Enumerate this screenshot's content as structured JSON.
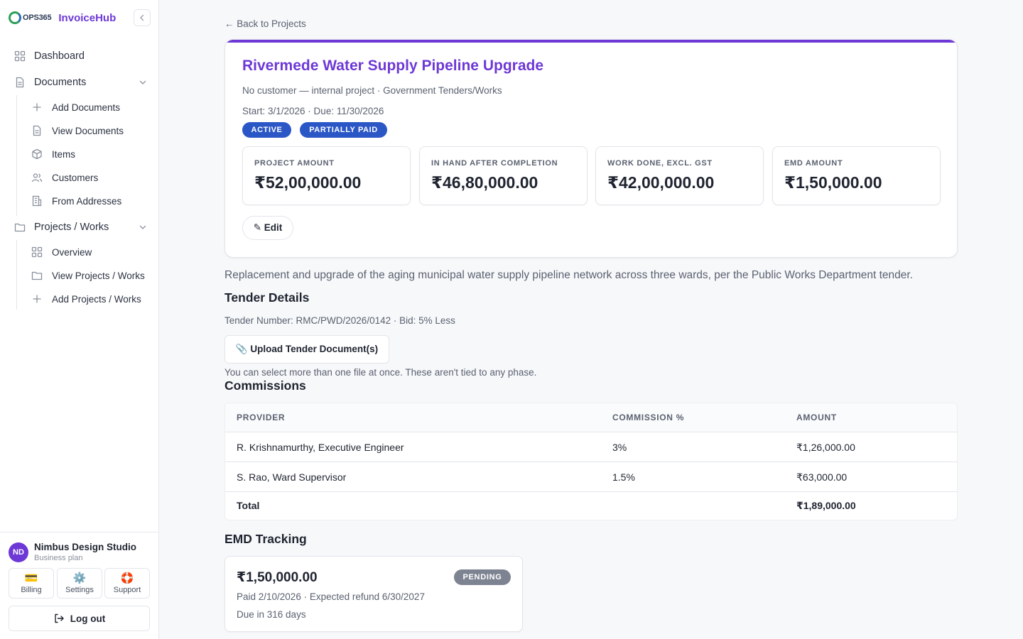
{
  "brand": {
    "logo_text": "OPS365",
    "app_name": "InvoiceHub"
  },
  "sidebar": {
    "items": [
      {
        "label": "Dashboard",
        "icon": "grid-icon"
      },
      {
        "label": "Documents",
        "icon": "document-icon",
        "expanded": true,
        "children": [
          {
            "label": "Add Documents",
            "icon": "plus-icon"
          },
          {
            "label": "View Documents",
            "icon": "document-icon"
          },
          {
            "label": "Items",
            "icon": "box-icon"
          },
          {
            "label": "Customers",
            "icon": "users-icon"
          },
          {
            "label": "From Addresses",
            "icon": "building-icon"
          }
        ]
      },
      {
        "label": "Projects / Works",
        "icon": "folder-icon",
        "expanded": true,
        "children": [
          {
            "label": "Overview",
            "icon": "grid-icon"
          },
          {
            "label": "View Projects / Works",
            "icon": "folder-icon"
          },
          {
            "label": "Add Projects / Works",
            "icon": "plus-icon"
          }
        ]
      }
    ],
    "account": {
      "initials": "ND",
      "name": "Nimbus Design Studio",
      "plan": "Business plan"
    },
    "footer_buttons": [
      {
        "label": "Billing",
        "icon": "credit-card-icon",
        "glyph": "💳"
      },
      {
        "label": "Settings",
        "icon": "gear-icon",
        "glyph": "⚙️"
      },
      {
        "label": "Support",
        "icon": "lifebuoy-icon",
        "glyph": "🛟"
      }
    ],
    "logout_label": "Log out"
  },
  "main": {
    "back_link": "← Back to Projects",
    "project": {
      "title": "Rivermede Water Supply Pipeline Upgrade",
      "subtitle": "No customer — internal project · Government Tenders/Works",
      "dates": "Start: 3/1/2026 · Due: 11/30/2026",
      "badges": [
        "ACTIVE",
        "PARTIALLY PAID"
      ],
      "accent_color": "#6d38d6",
      "stats": [
        {
          "label": "PROJECT AMOUNT",
          "value": "₹52,00,000.00"
        },
        {
          "label": "IN HAND AFTER COMPLETION",
          "value": "₹46,80,000.00"
        },
        {
          "label": "WORK DONE, EXCL. GST",
          "value": "₹42,00,000.00"
        },
        {
          "label": "EMD AMOUNT",
          "value": "₹1,50,000.00"
        }
      ],
      "edit_label": "✎ Edit"
    },
    "description": "Replacement and upgrade of the aging municipal water supply pipeline network across three wards, per the Public Works Department tender.",
    "tender": {
      "heading": "Tender Details",
      "info": "Tender Number: RMC/PWD/2026/0142 · Bid: 5% Less",
      "upload_label": "📎 Upload Tender Document(s)",
      "upload_hint": "You can select more than one file at once. These aren't tied to any phase."
    },
    "commissions": {
      "heading": "Commissions",
      "columns": [
        "PROVIDER",
        "COMMISSION %",
        "AMOUNT"
      ],
      "rows": [
        {
          "provider": "R. Krishnamurthy, Executive Engineer",
          "percent": "3%",
          "amount": "₹1,26,000.00"
        },
        {
          "provider": "S. Rao, Ward Supervisor",
          "percent": "1.5%",
          "amount": "₹63,000.00"
        }
      ],
      "total_label": "Total",
      "total_amount": "₹1,89,000.00"
    },
    "emd": {
      "heading": "EMD Tracking",
      "amount": "₹1,50,000.00",
      "status": "PENDING",
      "paid_line": "Paid 2/10/2026 · Expected refund 6/30/2027",
      "due_line": "Due in 316 days"
    }
  }
}
